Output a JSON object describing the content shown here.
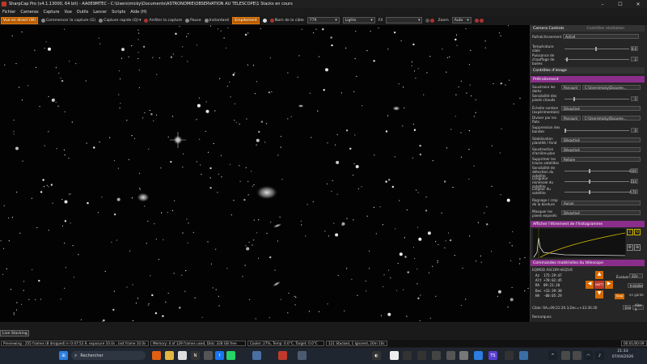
{
  "window": {
    "title": "SharpCap Pro (v4.1.13000, 64 bit) - AA0E9MTEC - C:\\Users\\micky\\Documents\\ASTRONOMIE\\OBSERVATION AU TELESCOPE\\1 Stacks en cours"
  },
  "menu": [
    "Fichier",
    "Cameras",
    "Capture",
    "Vue",
    "Outils",
    "Lancer",
    "Scripts",
    "Aide (H)"
  ],
  "toolbar": {
    "live_label": "Vue en direct (W)",
    "start_capture": "Commencer la capture (G)",
    "quick_capture": "Capture rapide (Q)",
    "stop_capture": "Arrêter la capture",
    "pause": "Pause",
    "snapshot": "Instantané",
    "stacking": "Empilement",
    "target_name": "Nom de la cible",
    "target_value": "779",
    "frame_type": "Lights",
    "fx_label": "FX",
    "zoom_label": "Zoom",
    "zoom_value": "Auto"
  },
  "panel": {
    "camera_controls": "Camera Controls",
    "camera_controls_check": "Contrôles révélation",
    "refresh_label": "Rafraîchissement",
    "refresh_value": "Activé",
    "temp_target_label": "Température cible",
    "temp_target_value": "0.0",
    "heater_label": "Puissance de chauffage de buées",
    "heater_value": "2",
    "image_controls": "Contrôles d'image",
    "preprocessing": "Prétraitement",
    "dark_label": "Soustraire les darks",
    "dark_btn": "Parcourir",
    "dark_path": "C:\\Users\\micky\\Docume...",
    "hot_px_label": "Sensibilité des pixels chauds",
    "hot_px_value": "5",
    "dark_scale_label": "Échelle sombre (expérimentale)",
    "dark_scale_value": "Désactivé",
    "flat_label": "Diviser par les flats",
    "flat_btn": "Parcourir",
    "flat_path": "C:\\Users\\micky\\Docume...",
    "banding_label": "Suppression des bandes",
    "banding_value": "0",
    "bg_label": "Stabilisation planéité / fond",
    "bg_value": "Désactivé",
    "bg_sub_label": "Soustraction d'arrière-plan",
    "bg_sub_value": "Désactivé",
    "trails_label": "Supprimer les traces satellites",
    "trails_value": "Refaire",
    "sens_label": "Sensibilité de détection du satellite",
    "sens_value": "8.60",
    "min_len_label": "Longueur minimale du satellite",
    "min_len_value": "234",
    "width_label": "Largeur du satellite",
    "width_value": "4.70",
    "crop_label": "Rognage / crop de la bordure",
    "crop_value": "Aucun",
    "mask_label": "Masquer les pixels exposés",
    "mask_value": "Désactivé",
    "histogram": "Afficher l'étirement de l'histogramme",
    "telescope": "Commandes matérielles du télescope",
    "mount_name": "EQMOD ASCOM HEQ5/6",
    "az": "175:29:47",
    "alt": "+78:02:45",
    "ra": "09:21:20",
    "dec": "+33:39:30",
    "ha": "-00:05:29",
    "evaluer": "Évaluer",
    "rate": "32x",
    "install": "Installer",
    "park": "en garde",
    "center_btn": "NATTI",
    "stop_btn": "Stop",
    "target_label": "Cible",
    "target_coords": "RA=09:21:20.3,Dec=+33:30:30",
    "go_btn": "Env",
    "goto_btn": "Aller à",
    "remarks": "Remarques"
  },
  "bottom": {
    "live_stacking": "Live Stacking",
    "previewing": "Previewing : 255 frames (8 dropped) in 0:47:52.9, exposure 10.0s , last frame 10.0s",
    "memory": "Memory: 4 of 129 frames used, Disk: 328 GB free",
    "cooler": "Cooler: 27%, Temp: 0.0°C, Target: 0.0°C",
    "stacked": "121 Stacked, 1 Ignored, 20m 10s",
    "frame_label": "Frame",
    "time_counter": "00:01/00:09"
  },
  "taskbar": {
    "search": "Rechercher",
    "time": "21:33",
    "date": "07/04/2026"
  },
  "colors": {
    "accent": "#b85c00",
    "purple": "#8b2e8b",
    "background": "#1e1e1e"
  }
}
